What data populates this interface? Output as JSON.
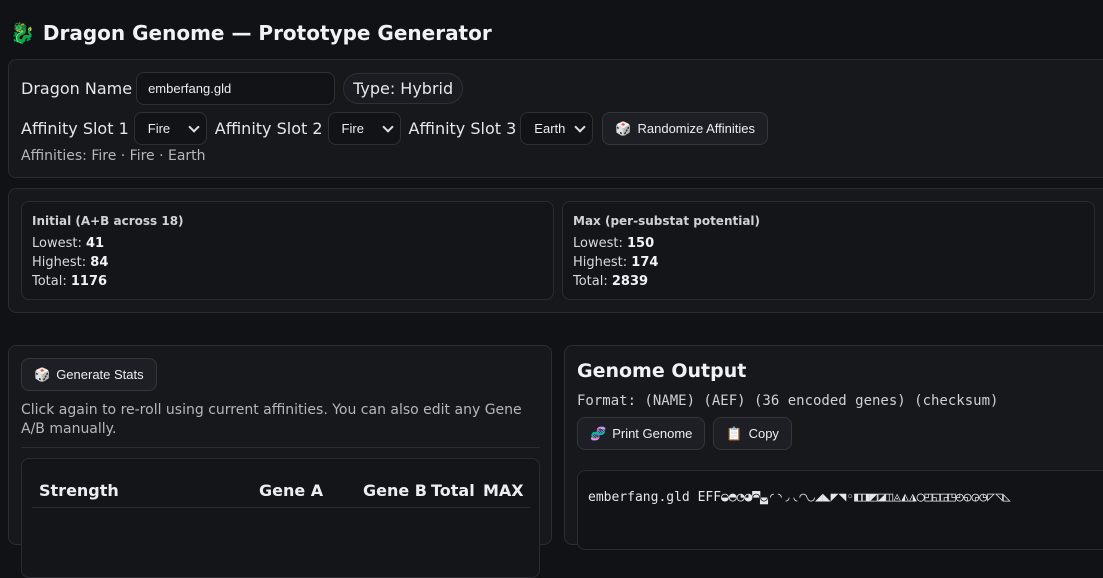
{
  "header": {
    "title": "Dragon Genome — Prototype Generator",
    "icon": "dragon-icon"
  },
  "form": {
    "name_label": "Dragon Name",
    "name_value": "emberfang.gld",
    "type_label": "Type: Hybrid",
    "slot1_label": "Affinity Slot 1",
    "slot1_value": "Fire",
    "slot2_label": "Affinity Slot 2",
    "slot2_value": "Fire",
    "slot3_label": "Affinity Slot 3",
    "slot3_value": "Earth",
    "randomize_label": "Randomize Affinities",
    "affinities_summary": "Affinities: Fire · Fire · Earth"
  },
  "stats": {
    "initial": {
      "title": "Initial (A+B across 18)",
      "lowest_label": "Lowest:",
      "lowest": "41",
      "highest_label": "Highest:",
      "highest": "84",
      "total_label": "Total:",
      "total": "1176"
    },
    "max": {
      "title": "Max (per-substat potential)",
      "lowest_label": "Lowest:",
      "lowest": "150",
      "highest_label": "Highest:",
      "highest": "174",
      "total_label": "Total:",
      "total": "2839"
    }
  },
  "generator": {
    "button_label": "Generate Stats",
    "hint": "Click again to re-roll using current affinities. You can also edit any Gene A/B manually.",
    "table_headers": {
      "stat": "Strength",
      "gene_a": "Gene A",
      "gene_b": "Gene B",
      "total": "Total",
      "max": "MAX"
    }
  },
  "genome": {
    "title": "Genome Output",
    "format": "Format: (NAME) (AEF) (36 encoded genes) (checksum)",
    "print_label": "Print Genome",
    "copy_label": "Copy",
    "output": "emberfang.gld EFF◒◓◔◕◚◛◜◝◞◟◠◡◢◣◤◥◦◧◨◩◪◫◬◭◮◯◰◱◲◳◴◵◶◷◸◹◺"
  }
}
